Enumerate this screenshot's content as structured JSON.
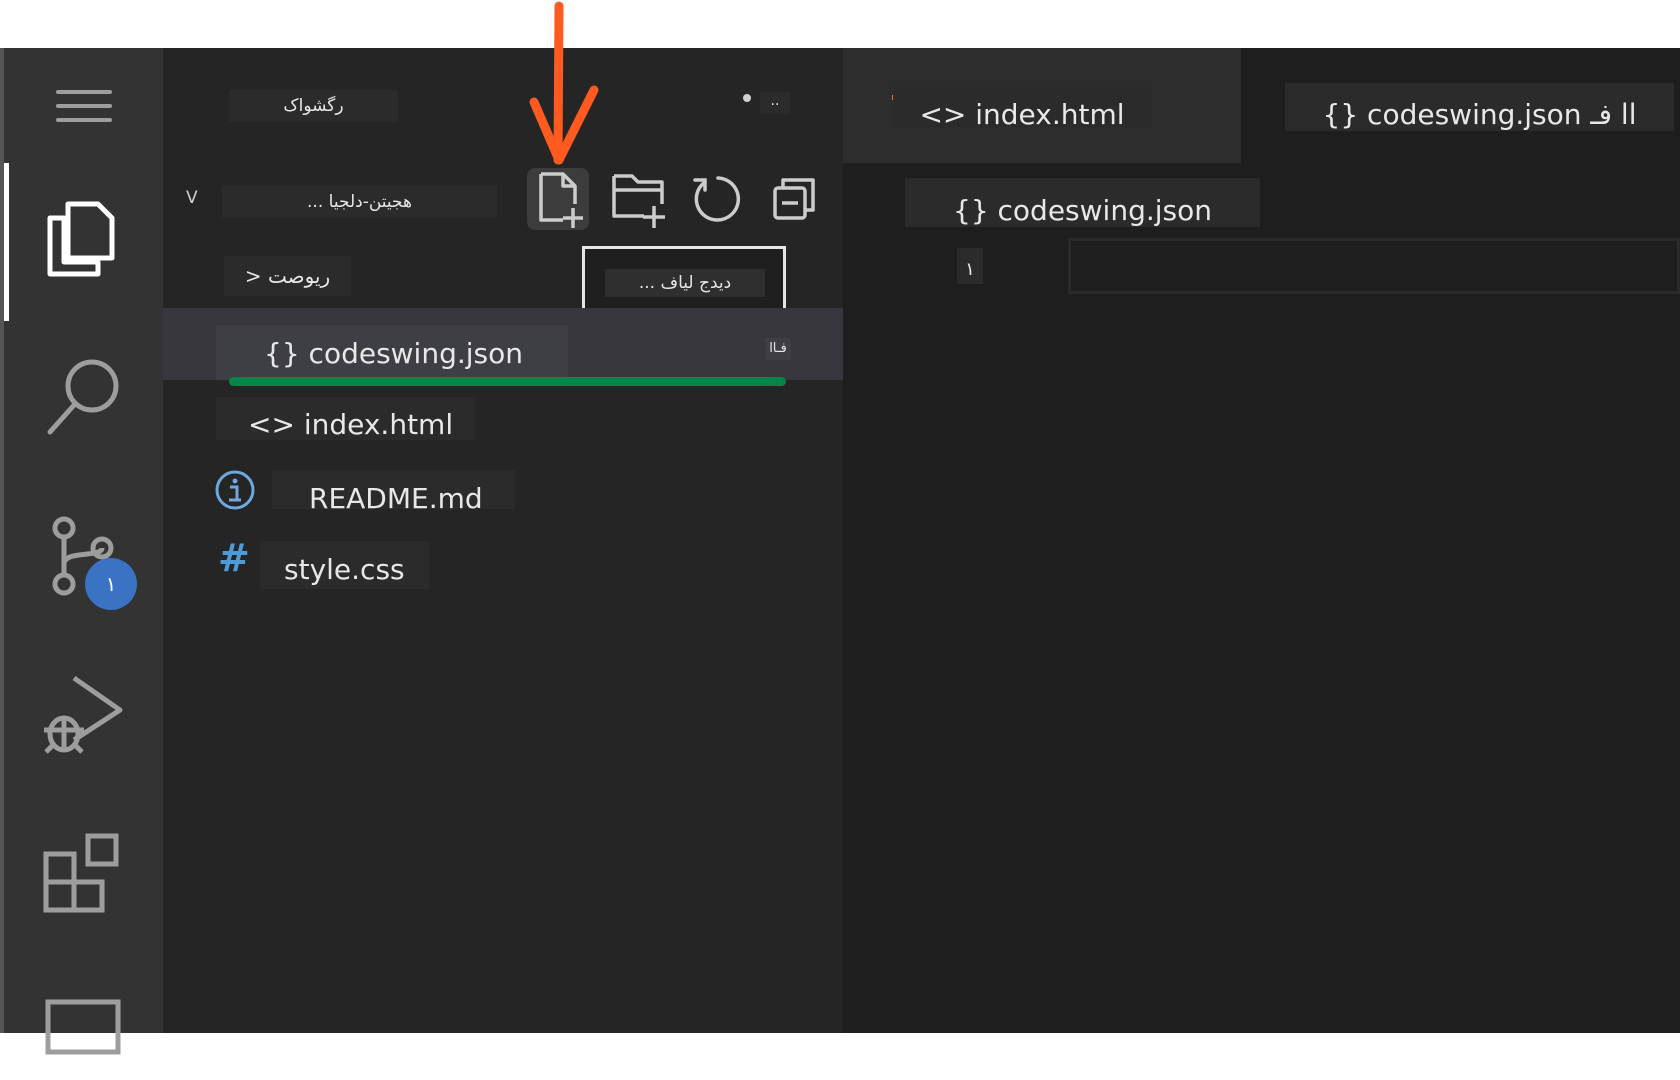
{
  "activity_bar": {
    "items": [
      "menu-icon",
      "explorer-icon",
      "search-icon",
      "source-control-icon",
      "run-debug-icon",
      "extensions-icon",
      "remote-explorer-icon"
    ],
    "source_control_badge": "١"
  },
  "sidebar": {
    "header_title": "رگشواک",
    "header_more": "..",
    "folder_toggle": "V",
    "folder_name": "... هجیتن-دلجیا",
    "outline_label": "> ریوصت",
    "tooltip": "... دیدج لیاف",
    "toolbar": {
      "new_file": "new-file-icon",
      "new_folder": "new-folder-icon",
      "refresh": "refresh-icon",
      "collapse": "collapse-all-icon"
    },
    "files": [
      {
        "icon": "{}",
        "name": "codeswing.json",
        "status": "فـاا"
      },
      {
        "icon": "<>",
        "name": "index.html"
      },
      {
        "icon": "info-icon",
        "name": "README.md"
      },
      {
        "icon": "#",
        "name": "style.css"
      }
    ]
  },
  "editor": {
    "tabs": [
      {
        "label": "<> index.html"
      },
      {
        "label": "{} codeswing.json اا فـ"
      }
    ],
    "breadcrumb": "{} codeswing.json",
    "line_number": "١"
  },
  "annotation": {
    "arrow_color": "#ff5a1f"
  },
  "colors": {
    "accent_green": "#06844a",
    "badge_blue": "#3b73c4",
    "hash_blue": "#4f9bd8",
    "info_blue": "#6fa8dc"
  }
}
